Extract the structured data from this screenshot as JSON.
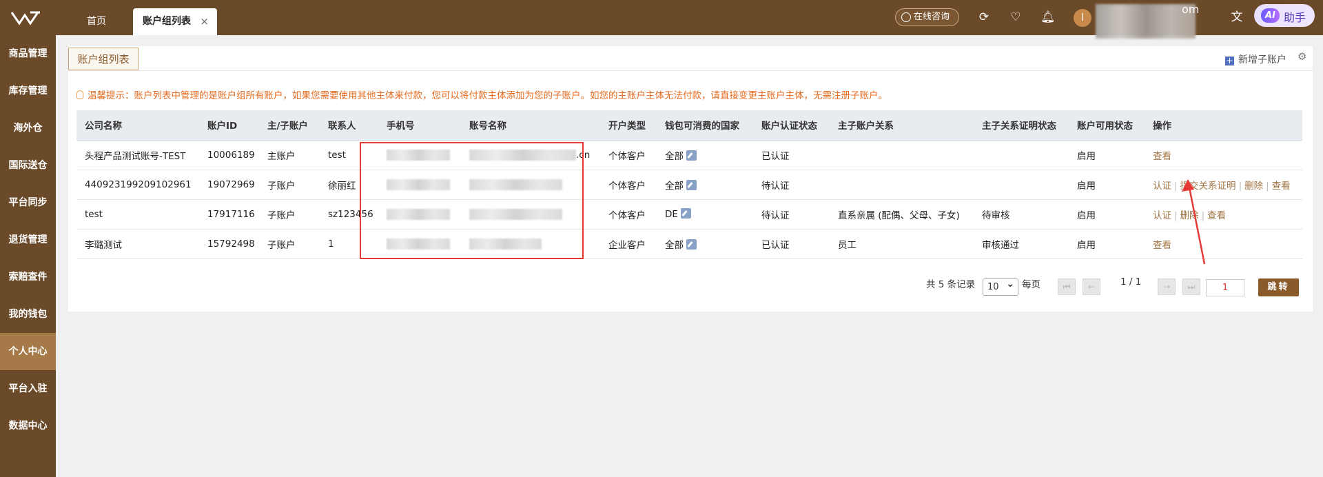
{
  "tabs": {
    "home": "首页",
    "active": "账户组列表",
    "close": "×"
  },
  "header": {
    "consult": "在线咨询",
    "user_tail": "om",
    "avatar_letter": "l",
    "ai_badge": "AI",
    "ai_label": "助手",
    "icons": [
      "logo-icon",
      "refresh-icon",
      "favorite-icon",
      "bell-icon",
      "translate-icon"
    ]
  },
  "sidebar": {
    "items": [
      "商品管理",
      "库存管理",
      "海外仓",
      "国际送仓",
      "平台同步",
      "退货管理",
      "索赔查件",
      "我的钱包",
      "个人中心",
      "平台入驻",
      "数据中心"
    ],
    "active_index": 8
  },
  "page": {
    "tab_title": "账户组列表",
    "add_sub": "新增子账户",
    "tip": "温馨提示：账户列表中管理的是账户组所有账户，如果您需要使用其他主体来付款，您可以将付款主体添加为您的子账户。如您的主账户主体无法付款，请直接变更主账户主体，无需注册子账户。"
  },
  "table": {
    "columns": [
      "公司名称",
      "账户ID",
      "主/子账户",
      "联系人",
      "手机号",
      "账号名称",
      "开户类型",
      "钱包可消费的国家",
      "账户认证状态",
      "主子账户关系",
      "主子关系证明状态",
      "账户可用状态",
      "操作"
    ],
    "rows": [
      {
        "company": "头程产品测试账号-TEST",
        "id": "10006189",
        "type": "主账户",
        "contact": "test",
        "account_tail": ".cn",
        "open_type": "个体客户",
        "country": "全部",
        "auth": "已认证",
        "relation": "",
        "proof": "",
        "status": "启用",
        "ops": [
          "查看"
        ]
      },
      {
        "company": "440923199209102961",
        "id": "19072969",
        "type": "子账户",
        "contact": "徐丽红",
        "account_tail": "",
        "open_type": "个体客户",
        "country": "全部",
        "auth": "待认证",
        "relation": "",
        "proof": "",
        "status": "启用",
        "ops": [
          "认证",
          "提交关系证明",
          "删除",
          "查看"
        ]
      },
      {
        "company": "test",
        "id": "17917116",
        "type": "子账户",
        "contact": "sz123456",
        "account_tail": "",
        "open_type": "个体客户",
        "country": "DE",
        "auth": "待认证",
        "relation": "直系亲属 (配偶、父母、子女)",
        "proof": "待审核",
        "status": "启用",
        "ops": [
          "认证",
          "删除",
          "查看"
        ]
      },
      {
        "company": "李璐测试",
        "id": "15792498",
        "type": "子账户",
        "contact": "1",
        "account_tail": "",
        "open_type": "企业客户",
        "country": "全部",
        "auth": "已认证",
        "relation": "员工",
        "proof": "审核通过",
        "status": "启用",
        "ops": [
          "查看"
        ]
      }
    ]
  },
  "pagination": {
    "total": "共 5 条记录",
    "page_size": "10",
    "per_page": "每页",
    "page_info": "1 / 1",
    "input_value": "1",
    "jump": "跳转"
  },
  "colors": {
    "brand": "#6b4a2a",
    "accent": "#a27546",
    "highlight": "#e53935",
    "tip": "#e56b1f"
  }
}
